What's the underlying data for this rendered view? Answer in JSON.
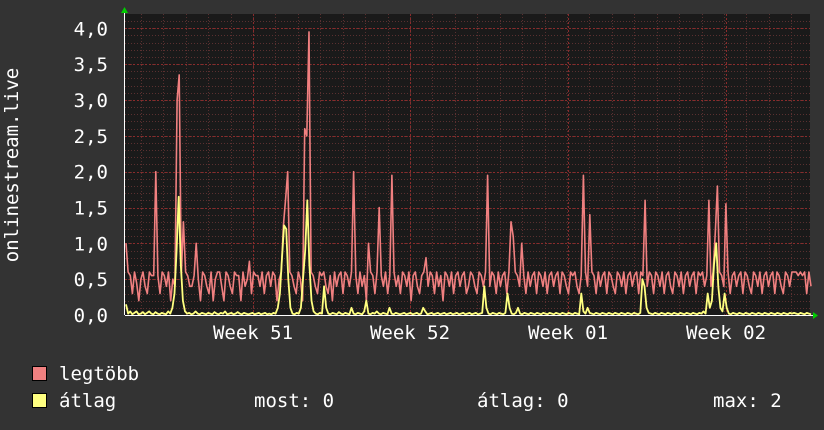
{
  "chart_data": {
    "type": "line",
    "ylabel": "onlinestream.live",
    "ylim": [
      0,
      4.2
    ],
    "y_ticks": [
      "0,0",
      "0,5",
      "1,0",
      "1,5",
      "2,0",
      "2,5",
      "3,0",
      "3,5",
      "4,0"
    ],
    "y_tick_values": [
      0,
      0.5,
      1.0,
      1.5,
      2.0,
      2.5,
      3.0,
      3.5,
      4.0
    ],
    "x_ticks": [
      "Week 51",
      "Week 52",
      "Week 01",
      "Week 02"
    ],
    "grid": true,
    "series": [
      {
        "name": "legtöbb",
        "color": "#f08080",
        "values": [
          1.0,
          0.6,
          0.55,
          0.3,
          0.6,
          0.45,
          0.2,
          0.5,
          0.6,
          0.4,
          0.3,
          0.6,
          0.55,
          0.55,
          2.0,
          0.55,
          0.3,
          0.6,
          0.55,
          0.4,
          0.6,
          0.2,
          0.5,
          0.4,
          3.0,
          3.35,
          0.55,
          1.3,
          0.6,
          0.55,
          0.4,
          0.4,
          0.55,
          1.0,
          0.5,
          0.2,
          0.6,
          0.55,
          0.4,
          0.3,
          0.6,
          0.2,
          0.5,
          0.6,
          0.6,
          0.4,
          0.2,
          0.6,
          0.55,
          0.4,
          0.3,
          0.6,
          0.55,
          0.55,
          0.2,
          0.6,
          0.4,
          0.5,
          0.75,
          0.3,
          0.6,
          0.55,
          0.55,
          0.4,
          0.6,
          0.3,
          0.55,
          0.6,
          0.4,
          0.6,
          0.55,
          0.2,
          0.5,
          0.6,
          1.25,
          1.6,
          2.0,
          0.6,
          0.55,
          0.4,
          0.3,
          0.6,
          0.5,
          0.2,
          2.6,
          2.5,
          3.95,
          0.6,
          0.55,
          0.4,
          0.3,
          0.6,
          0.55,
          0.6,
          0.4,
          0.3,
          0.55,
          0.2,
          0.6,
          0.4,
          0.55,
          0.6,
          0.3,
          0.6,
          0.55,
          0.4,
          0.6,
          2.0,
          0.55,
          0.3,
          0.6,
          0.4,
          0.55,
          0.2,
          1.0,
          0.6,
          0.55,
          0.3,
          0.6,
          1.5,
          0.55,
          0.4,
          0.6,
          0.3,
          0.55,
          1.95,
          0.6,
          0.4,
          0.55,
          0.3,
          0.6,
          0.55,
          0.4,
          0.6,
          0.2,
          0.55,
          0.6,
          0.4,
          0.3,
          0.55,
          0.6,
          0.8,
          0.4,
          0.6,
          0.55,
          0.3,
          0.6,
          0.4,
          0.55,
          0.2,
          0.6,
          0.55,
          0.4,
          0.6,
          0.3,
          0.55,
          0.6,
          0.4,
          0.55,
          0.6,
          0.3,
          0.4,
          0.6,
          0.55,
          0.4,
          0.3,
          0.6,
          0.55,
          0.4,
          0.6,
          1.95,
          0.4,
          0.6,
          0.55,
          0.3,
          0.6,
          0.4,
          0.55,
          0.6,
          0.3,
          0.6,
          1.3,
          1.1,
          0.6,
          0.55,
          0.4,
          1.0,
          0.55,
          0.3,
          0.6,
          0.4,
          0.55,
          0.6,
          0.3,
          0.6,
          0.55,
          0.4,
          0.6,
          0.3,
          0.55,
          0.6,
          0.4,
          0.55,
          0.6,
          0.3,
          0.6,
          0.55,
          0.4,
          0.3,
          0.6,
          0.55,
          0.6,
          0.4,
          0.3,
          0.55,
          1.95,
          0.6,
          0.4,
          1.4,
          0.6,
          0.55,
          0.3,
          0.6,
          0.4,
          0.55,
          0.6,
          0.3,
          0.6,
          0.55,
          0.4,
          0.3,
          0.6,
          0.55,
          0.4,
          0.6,
          0.3,
          0.55,
          0.6,
          0.4,
          0.55,
          0.6,
          0.3,
          0.6,
          0.55,
          1.6,
          0.4,
          0.6,
          0.55,
          0.3,
          0.6,
          0.55,
          0.4,
          0.6,
          0.3,
          0.55,
          0.6,
          0.4,
          0.3,
          0.6,
          0.55,
          0.4,
          0.6,
          0.3,
          0.55,
          0.6,
          0.4,
          0.55,
          0.6,
          0.3,
          0.6,
          0.55,
          0.6,
          0.4,
          0.55,
          1.6,
          0.4,
          0.6,
          1.15,
          1.8,
          0.6,
          0.55,
          0.4,
          1.55,
          0.6,
          0.3,
          0.55,
          0.6,
          0.4,
          0.55,
          0.6,
          0.3,
          0.6,
          0.55,
          0.4,
          0.3,
          0.6,
          0.55,
          0.4,
          0.6,
          0.3,
          0.55,
          0.6,
          0.4,
          0.55,
          0.6,
          0.3,
          0.6,
          0.55,
          0.4,
          0.3,
          0.6,
          0.55,
          0.4,
          0.6,
          0.6,
          0.6,
          0.55,
          0.6,
          0.55,
          0.6,
          0.3,
          0.6,
          0.4
        ]
      },
      {
        "name": "átlag",
        "color": "#ffff80",
        "values": [
          0.15,
          0.02,
          0.05,
          0.01,
          0.03,
          0.05,
          0.01,
          0.02,
          0.04,
          0.01,
          0.03,
          0.05,
          0.02,
          0.01,
          0.04,
          0.02,
          0.01,
          0.03,
          0.02,
          0.01,
          0.05,
          0.02,
          0.1,
          0.3,
          0.9,
          1.65,
          0.7,
          0.2,
          0.05,
          0.02,
          0.03,
          0.01,
          0.02,
          0.05,
          0.02,
          0.01,
          0.03,
          0.02,
          0.01,
          0.03,
          0.02,
          0.01,
          0.04,
          0.02,
          0.01,
          0.03,
          0.02,
          0.05,
          0.01,
          0.02,
          0.03,
          0.01,
          0.02,
          0.04,
          0.02,
          0.01,
          0.03,
          0.02,
          0.01,
          0.02,
          0.03,
          0.01,
          0.02,
          0.03,
          0.01,
          0.02,
          0.03,
          0.01,
          0.02,
          0.01,
          0.03,
          0.02,
          0.1,
          0.3,
          0.8,
          1.25,
          1.2,
          0.5,
          0.1,
          0.02,
          0.01,
          0.03,
          0.02,
          0.1,
          0.5,
          0.9,
          1.6,
          0.7,
          0.2,
          0.05,
          0.02,
          0.01,
          0.03,
          0.02,
          0.4,
          0.1,
          0.02,
          0.01,
          0.03,
          0.02,
          0.01,
          0.04,
          0.02,
          0.01,
          0.03,
          0.02,
          0.01,
          0.1,
          0.02,
          0.01,
          0.03,
          0.02,
          0.01,
          0.05,
          0.2,
          0.02,
          0.01,
          0.03,
          0.02,
          0.05,
          0.02,
          0.01,
          0.03,
          0.02,
          0.01,
          0.1,
          0.02,
          0.01,
          0.03,
          0.02,
          0.01,
          0.02,
          0.03,
          0.01,
          0.02,
          0.03,
          0.01,
          0.02,
          0.03,
          0.01,
          0.02,
          0.1,
          0.05,
          0.01,
          0.02,
          0.03,
          0.01,
          0.02,
          0.03,
          0.01,
          0.02,
          0.03,
          0.01,
          0.02,
          0.03,
          0.01,
          0.02,
          0.03,
          0.01,
          0.02,
          0.03,
          0.01,
          0.02,
          0.03,
          0.01,
          0.02,
          0.03,
          0.01,
          0.02,
          0.03,
          0.4,
          0.1,
          0.02,
          0.01,
          0.03,
          0.02,
          0.01,
          0.03,
          0.02,
          0.01,
          0.03,
          0.3,
          0.1,
          0.02,
          0.01,
          0.03,
          0.1,
          0.02,
          0.01,
          0.03,
          0.02,
          0.01,
          0.03,
          0.02,
          0.01,
          0.03,
          0.02,
          0.01,
          0.03,
          0.02,
          0.01,
          0.03,
          0.02,
          0.01,
          0.03,
          0.02,
          0.01,
          0.03,
          0.02,
          0.01,
          0.03,
          0.02,
          0.01,
          0.03,
          0.02,
          0.01,
          0.3,
          0.05,
          0.02,
          0.1,
          0.03,
          0.02,
          0.01,
          0.03,
          0.02,
          0.01,
          0.03,
          0.02,
          0.01,
          0.03,
          0.02,
          0.01,
          0.03,
          0.02,
          0.01,
          0.03,
          0.02,
          0.01,
          0.03,
          0.02,
          0.01,
          0.03,
          0.02,
          0.01,
          0.03,
          0.5,
          0.4,
          0.1,
          0.03,
          0.02,
          0.01,
          0.03,
          0.02,
          0.01,
          0.03,
          0.02,
          0.01,
          0.03,
          0.02,
          0.01,
          0.03,
          0.02,
          0.01,
          0.03,
          0.02,
          0.01,
          0.03,
          0.02,
          0.01,
          0.03,
          0.02,
          0.01,
          0.03,
          0.02,
          0.05,
          0.02,
          0.3,
          0.1,
          0.2,
          0.7,
          1.0,
          0.4,
          0.1,
          0.05,
          0.3,
          0.1,
          0.02,
          0.01,
          0.03,
          0.02,
          0.01,
          0.03,
          0.02,
          0.01,
          0.03,
          0.02,
          0.01,
          0.03,
          0.02,
          0.01,
          0.03,
          0.02,
          0.01,
          0.03,
          0.02,
          0.01,
          0.03,
          0.02,
          0.01,
          0.03,
          0.02,
          0.01,
          0.03,
          0.02,
          0.01,
          0.03,
          0.02,
          0.03,
          0.02,
          0.01,
          0.03,
          0.02,
          0.01,
          0.03,
          0.02,
          0.01
        ]
      }
    ]
  },
  "stats": {
    "most_label": "most:",
    "most_value": "0",
    "atlag_label": "átlag:",
    "atlag_value": "0",
    "max_label": "max:",
    "max_value": "2"
  },
  "colors": {
    "background": "#333333",
    "plot_background": "#1a1a1a",
    "grid_major": "#8a2b2b",
    "grid_minor": "#5a3030",
    "axis_arrow": "#00cc00"
  }
}
